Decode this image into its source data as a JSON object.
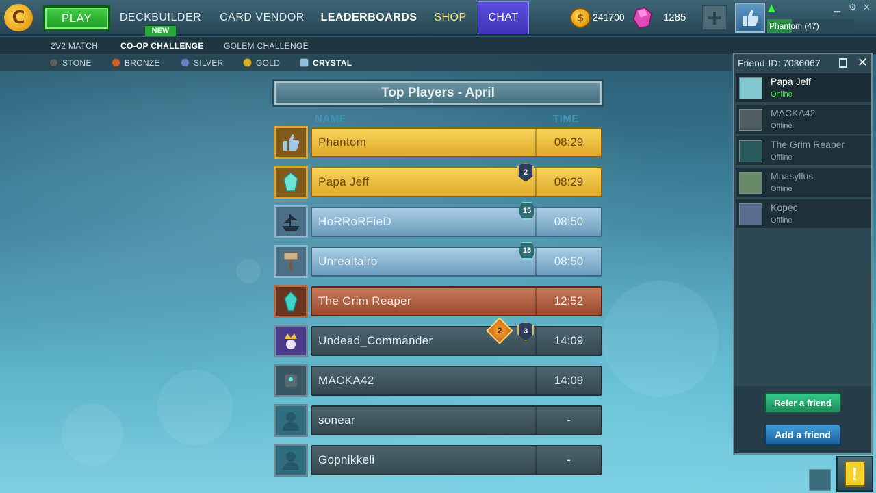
{
  "nav": {
    "play": "PLAY",
    "deckbuilder": "DECKBUILDER",
    "new_badge": "NEW",
    "card_vendor": "CARD VENDOR",
    "leaderboards": "LEADERBOARDS",
    "shop": "SHOP",
    "chat": "CHAT",
    "gold": "241700",
    "gems": "1285",
    "profile": "Phantom (47)"
  },
  "modes": [
    "2V2 MATCH",
    "CO-OP CHALLENGE",
    "GOLEM CHALLENGE"
  ],
  "active_mode": "CO-OP CHALLENGE",
  "leagues": [
    {
      "label": "STONE",
      "color": "#5a5e60"
    },
    {
      "label": "BRONZE",
      "color": "#c8652c"
    },
    {
      "label": "SILVER",
      "color": "#6f7dc4"
    },
    {
      "label": "GOLD",
      "color": "#d9b42a"
    },
    {
      "label": "CRYSTAL",
      "color": "#8fc0dc"
    }
  ],
  "active_league": "CRYSTAL",
  "board": {
    "title": "Top Players - April",
    "col_name": "NAME",
    "col_time": "TIME",
    "rows": [
      {
        "name": "Phantom",
        "time": "08:29",
        "tier": "gold",
        "avatar": "thumbs-up"
      },
      {
        "name": "Papa Jeff",
        "time": "08:29",
        "tier": "gold",
        "avatar": "crystal"
      },
      {
        "name": "HoRRoRFieD",
        "time": "08:50",
        "tier": "silver",
        "avatar": "ship"
      },
      {
        "name": "Unrealtairo",
        "time": "08:50",
        "tier": "silver",
        "avatar": "sign"
      },
      {
        "name": "The Grim Reaper",
        "time": "12:52",
        "tier": "bronze",
        "avatar": "crystal"
      },
      {
        "name": "Undead_Commander",
        "time": "14:09",
        "tier": "none",
        "avatar": "king"
      },
      {
        "name": "MACKA42",
        "time": "14:09",
        "tier": "none",
        "avatar": "golem"
      },
      {
        "name": "sonear",
        "time": "-",
        "tier": "none",
        "avatar": "silhouette"
      },
      {
        "name": "Gopnikkeli",
        "time": "-",
        "tier": "none",
        "avatar": "silhouette"
      }
    ],
    "badges": {
      "papa_jeff": "2",
      "horrorfied": "15",
      "unrealtairo": "15",
      "undead_diamond": "2",
      "undead_shield": "3"
    }
  },
  "friends": {
    "header": "Friend-ID: 7036067",
    "list": [
      {
        "name": "Papa Jeff",
        "status": "Online"
      },
      {
        "name": "MACKA42",
        "status": "Offline"
      },
      {
        "name": "The Grim Reaper",
        "status": "Offline"
      },
      {
        "name": "Mnasyllus",
        "status": "Offline"
      },
      {
        "name": "Kopec",
        "status": "Offline"
      }
    ],
    "refer": "Refer a friend",
    "add": "Add a friend"
  },
  "alert": "!"
}
